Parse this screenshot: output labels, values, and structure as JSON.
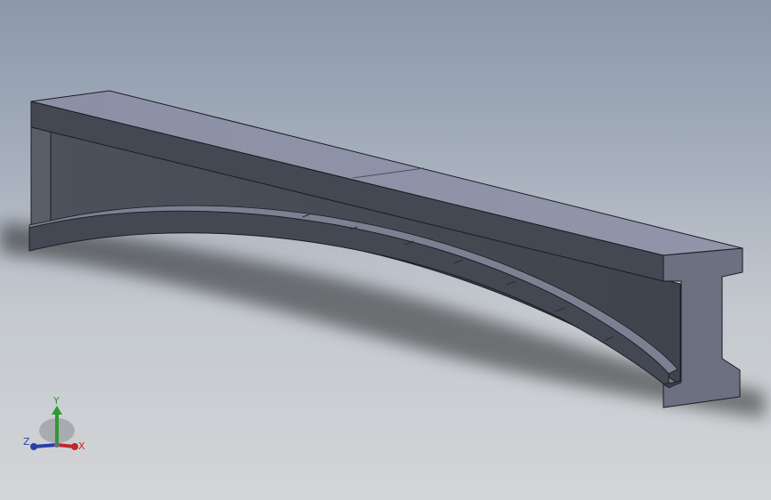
{
  "viewport": {
    "background_top": "#8c98aa",
    "background_bottom": "#d3d5d7"
  },
  "model": {
    "part": "tapered-i-beam",
    "top_face_color": "#8d91a6",
    "side_face_color": "#4a4e58",
    "end_face_color": "#6d7180",
    "edge_color": "#1b1c22"
  },
  "triad": {
    "x_label": "X",
    "y_label": "Y",
    "z_label": "Z",
    "x_color": "#c0282d",
    "y_color": "#2e9a2e",
    "z_color": "#2c3fa8"
  }
}
